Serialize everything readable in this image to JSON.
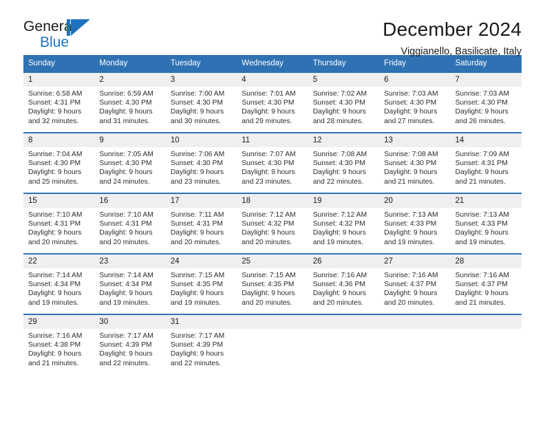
{
  "logo": {
    "word_top": "General",
    "word_bottom": "Blue",
    "mark_name": "general-blue-sail-logo"
  },
  "header": {
    "title": "December 2024",
    "subtitle": "Viggianello, Basilicate, Italy"
  },
  "colors": {
    "header_blue": "#2f72b4",
    "logo_blue": "#1f72c0",
    "daynum_gray": "#efefef",
    "text": "#1a1a1a"
  },
  "calendar": {
    "weekday_headers": [
      "Sunday",
      "Monday",
      "Tuesday",
      "Wednesday",
      "Thursday",
      "Friday",
      "Saturday"
    ],
    "weeks": [
      [
        {
          "day": "1",
          "sunrise": "Sunrise: 6:58 AM",
          "sunset": "Sunset: 4:31 PM",
          "daylight_line1": "Daylight: 9 hours",
          "daylight_line2": "and 32 minutes."
        },
        {
          "day": "2",
          "sunrise": "Sunrise: 6:59 AM",
          "sunset": "Sunset: 4:30 PM",
          "daylight_line1": "Daylight: 9 hours",
          "daylight_line2": "and 31 minutes."
        },
        {
          "day": "3",
          "sunrise": "Sunrise: 7:00 AM",
          "sunset": "Sunset: 4:30 PM",
          "daylight_line1": "Daylight: 9 hours",
          "daylight_line2": "and 30 minutes."
        },
        {
          "day": "4",
          "sunrise": "Sunrise: 7:01 AM",
          "sunset": "Sunset: 4:30 PM",
          "daylight_line1": "Daylight: 9 hours",
          "daylight_line2": "and 29 minutes."
        },
        {
          "day": "5",
          "sunrise": "Sunrise: 7:02 AM",
          "sunset": "Sunset: 4:30 PM",
          "daylight_line1": "Daylight: 9 hours",
          "daylight_line2": "and 28 minutes."
        },
        {
          "day": "6",
          "sunrise": "Sunrise: 7:03 AM",
          "sunset": "Sunset: 4:30 PM",
          "daylight_line1": "Daylight: 9 hours",
          "daylight_line2": "and 27 minutes."
        },
        {
          "day": "7",
          "sunrise": "Sunrise: 7:03 AM",
          "sunset": "Sunset: 4:30 PM",
          "daylight_line1": "Daylight: 9 hours",
          "daylight_line2": "and 26 minutes."
        }
      ],
      [
        {
          "day": "8",
          "sunrise": "Sunrise: 7:04 AM",
          "sunset": "Sunset: 4:30 PM",
          "daylight_line1": "Daylight: 9 hours",
          "daylight_line2": "and 25 minutes."
        },
        {
          "day": "9",
          "sunrise": "Sunrise: 7:05 AM",
          "sunset": "Sunset: 4:30 PM",
          "daylight_line1": "Daylight: 9 hours",
          "daylight_line2": "and 24 minutes."
        },
        {
          "day": "10",
          "sunrise": "Sunrise: 7:06 AM",
          "sunset": "Sunset: 4:30 PM",
          "daylight_line1": "Daylight: 9 hours",
          "daylight_line2": "and 23 minutes."
        },
        {
          "day": "11",
          "sunrise": "Sunrise: 7:07 AM",
          "sunset": "Sunset: 4:30 PM",
          "daylight_line1": "Daylight: 9 hours",
          "daylight_line2": "and 23 minutes."
        },
        {
          "day": "12",
          "sunrise": "Sunrise: 7:08 AM",
          "sunset": "Sunset: 4:30 PM",
          "daylight_line1": "Daylight: 9 hours",
          "daylight_line2": "and 22 minutes."
        },
        {
          "day": "13",
          "sunrise": "Sunrise: 7:08 AM",
          "sunset": "Sunset: 4:30 PM",
          "daylight_line1": "Daylight: 9 hours",
          "daylight_line2": "and 21 minutes."
        },
        {
          "day": "14",
          "sunrise": "Sunrise: 7:09 AM",
          "sunset": "Sunset: 4:31 PM",
          "daylight_line1": "Daylight: 9 hours",
          "daylight_line2": "and 21 minutes."
        }
      ],
      [
        {
          "day": "15",
          "sunrise": "Sunrise: 7:10 AM",
          "sunset": "Sunset: 4:31 PM",
          "daylight_line1": "Daylight: 9 hours",
          "daylight_line2": "and 20 minutes."
        },
        {
          "day": "16",
          "sunrise": "Sunrise: 7:10 AM",
          "sunset": "Sunset: 4:31 PM",
          "daylight_line1": "Daylight: 9 hours",
          "daylight_line2": "and 20 minutes."
        },
        {
          "day": "17",
          "sunrise": "Sunrise: 7:11 AM",
          "sunset": "Sunset: 4:31 PM",
          "daylight_line1": "Daylight: 9 hours",
          "daylight_line2": "and 20 minutes."
        },
        {
          "day": "18",
          "sunrise": "Sunrise: 7:12 AM",
          "sunset": "Sunset: 4:32 PM",
          "daylight_line1": "Daylight: 9 hours",
          "daylight_line2": "and 20 minutes."
        },
        {
          "day": "19",
          "sunrise": "Sunrise: 7:12 AM",
          "sunset": "Sunset: 4:32 PM",
          "daylight_line1": "Daylight: 9 hours",
          "daylight_line2": "and 19 minutes."
        },
        {
          "day": "20",
          "sunrise": "Sunrise: 7:13 AM",
          "sunset": "Sunset: 4:33 PM",
          "daylight_line1": "Daylight: 9 hours",
          "daylight_line2": "and 19 minutes."
        },
        {
          "day": "21",
          "sunrise": "Sunrise: 7:13 AM",
          "sunset": "Sunset: 4:33 PM",
          "daylight_line1": "Daylight: 9 hours",
          "daylight_line2": "and 19 minutes."
        }
      ],
      [
        {
          "day": "22",
          "sunrise": "Sunrise: 7:14 AM",
          "sunset": "Sunset: 4:34 PM",
          "daylight_line1": "Daylight: 9 hours",
          "daylight_line2": "and 19 minutes."
        },
        {
          "day": "23",
          "sunrise": "Sunrise: 7:14 AM",
          "sunset": "Sunset: 4:34 PM",
          "daylight_line1": "Daylight: 9 hours",
          "daylight_line2": "and 19 minutes."
        },
        {
          "day": "24",
          "sunrise": "Sunrise: 7:15 AM",
          "sunset": "Sunset: 4:35 PM",
          "daylight_line1": "Daylight: 9 hours",
          "daylight_line2": "and 19 minutes."
        },
        {
          "day": "25",
          "sunrise": "Sunrise: 7:15 AM",
          "sunset": "Sunset: 4:35 PM",
          "daylight_line1": "Daylight: 9 hours",
          "daylight_line2": "and 20 minutes."
        },
        {
          "day": "26",
          "sunrise": "Sunrise: 7:16 AM",
          "sunset": "Sunset: 4:36 PM",
          "daylight_line1": "Daylight: 9 hours",
          "daylight_line2": "and 20 minutes."
        },
        {
          "day": "27",
          "sunrise": "Sunrise: 7:16 AM",
          "sunset": "Sunset: 4:37 PM",
          "daylight_line1": "Daylight: 9 hours",
          "daylight_line2": "and 20 minutes."
        },
        {
          "day": "28",
          "sunrise": "Sunrise: 7:16 AM",
          "sunset": "Sunset: 4:37 PM",
          "daylight_line1": "Daylight: 9 hours",
          "daylight_line2": "and 21 minutes."
        }
      ],
      [
        {
          "day": "29",
          "sunrise": "Sunrise: 7:16 AM",
          "sunset": "Sunset: 4:38 PM",
          "daylight_line1": "Daylight: 9 hours",
          "daylight_line2": "and 21 minutes."
        },
        {
          "day": "30",
          "sunrise": "Sunrise: 7:17 AM",
          "sunset": "Sunset: 4:39 PM",
          "daylight_line1": "Daylight: 9 hours",
          "daylight_line2": "and 22 minutes."
        },
        {
          "day": "31",
          "sunrise": "Sunrise: 7:17 AM",
          "sunset": "Sunset: 4:39 PM",
          "daylight_line1": "Daylight: 9 hours",
          "daylight_line2": "and 22 minutes."
        },
        {
          "day": "",
          "sunrise": "",
          "sunset": "",
          "daylight_line1": "",
          "daylight_line2": ""
        },
        {
          "day": "",
          "sunrise": "",
          "sunset": "",
          "daylight_line1": "",
          "daylight_line2": ""
        },
        {
          "day": "",
          "sunrise": "",
          "sunset": "",
          "daylight_line1": "",
          "daylight_line2": ""
        },
        {
          "day": "",
          "sunrise": "",
          "sunset": "",
          "daylight_line1": "",
          "daylight_line2": ""
        }
      ]
    ]
  }
}
